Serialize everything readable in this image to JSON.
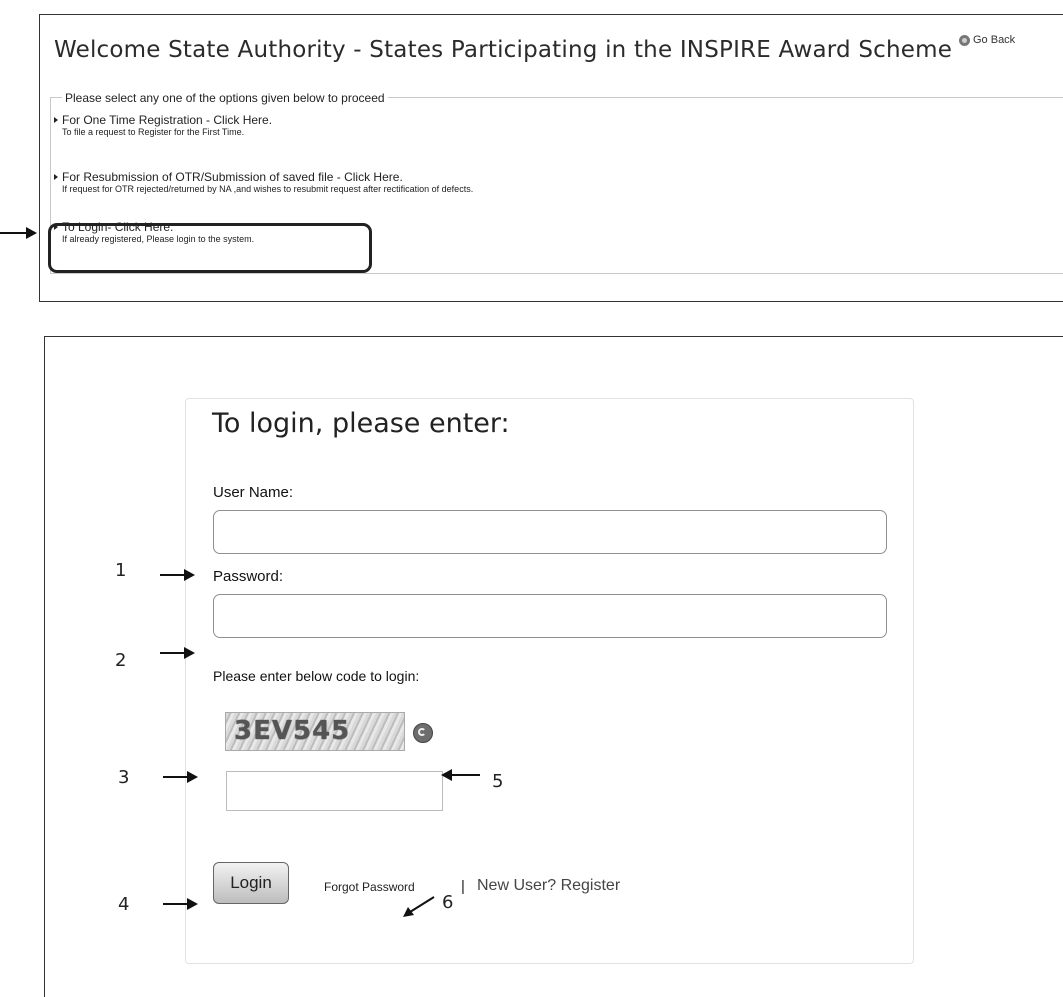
{
  "top": {
    "title": "Welcome State Authority - States Participating in the INSPIRE Award Scheme",
    "go_back": "Go Back",
    "legend": "Please select any one of the options given below to proceed",
    "options": [
      {
        "title": "For One Time Registration - Click Here.",
        "sub": "To file a request to Register for the First Time."
      },
      {
        "title": "For Resubmission of OTR/Submission of saved file - Click Here.",
        "sub": "If request for OTR rejected/returned by NA ,and wishes to resubmit request after rectification of defects."
      },
      {
        "title": "To Login- Click Here.",
        "sub": "If already registered, Please login to the system."
      }
    ]
  },
  "login": {
    "heading": "To login, please enter:",
    "username_label": "User Name:",
    "username_value": "",
    "password_label": "Password:",
    "password_value": "",
    "captcha_prompt": "Please enter below code to login:",
    "captcha_code": "3EV545",
    "captcha_value": "",
    "login_button": "Login",
    "forgot_password": "Forgot Password",
    "separator": "|",
    "new_user": "New User? Register"
  },
  "annotations": [
    "1",
    "2",
    "3",
    "4",
    "5",
    "6"
  ],
  "icons": {
    "go_back": "circle-arrow-icon",
    "refresh": "refresh-icon",
    "bullet": "chevron-right-icon"
  }
}
